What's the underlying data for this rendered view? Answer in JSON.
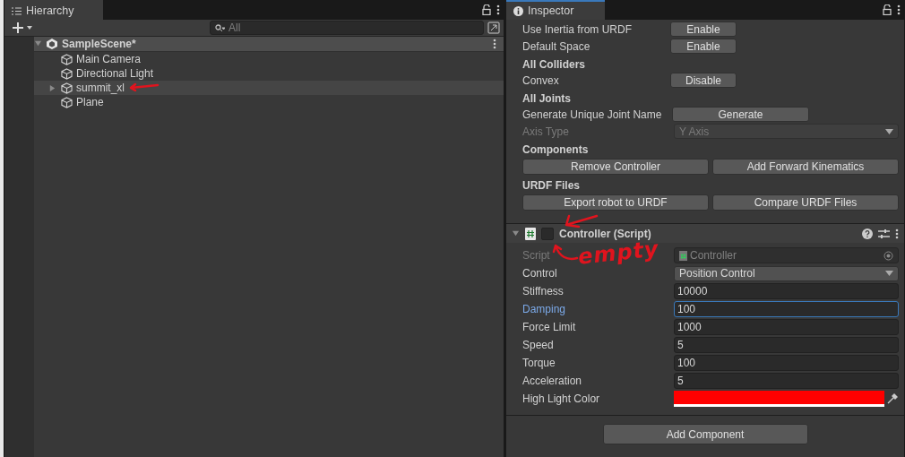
{
  "hierarchy": {
    "tab": {
      "label": "Hierarchy",
      "selected": true
    },
    "search": {
      "placeholder": "All"
    },
    "scene": {
      "name": "SampleScene*",
      "expanded": true
    },
    "objects": [
      {
        "name": "Main Camera",
        "has_children": false,
        "highlighted": false
      },
      {
        "name": "Directional Light",
        "has_children": false,
        "highlighted": false
      },
      {
        "name": "summit_xl",
        "has_children": true,
        "highlighted": true
      },
      {
        "name": "Plane",
        "has_children": false,
        "highlighted": false
      }
    ]
  },
  "inspector": {
    "tab": {
      "label": "Inspector",
      "selected": true
    },
    "items": [
      {
        "kind": "button_row",
        "label": "Use Inertia from URDF",
        "button": "Enable"
      },
      {
        "kind": "button_row",
        "label": "Default Space",
        "button": "Enable"
      },
      {
        "kind": "heading",
        "label": "All Colliders"
      },
      {
        "kind": "button_row",
        "label": "Convex",
        "button": "Disable"
      },
      {
        "kind": "heading",
        "label": "All Joints"
      },
      {
        "kind": "wide_button_row",
        "label": "Generate Unique Joint Name",
        "button": "Generate"
      },
      {
        "kind": "dropdown_row",
        "label": "Axis Type",
        "value": "Y Axis",
        "disabled": true
      },
      {
        "kind": "heading",
        "label": "Components"
      },
      {
        "kind": "button_pair",
        "buttons": [
          "Remove Controller",
          "Add Forward Kinematics"
        ]
      },
      {
        "kind": "heading",
        "label": "URDF Files"
      },
      {
        "kind": "button_pair",
        "buttons": [
          "Export robot to URDF",
          "Compare URDF Files"
        ]
      }
    ],
    "component": {
      "title": "Controller (Script)",
      "expanded": true,
      "enabled": false,
      "fields": [
        {
          "kind": "object",
          "label": "Script",
          "value": "Controller",
          "disabled": true,
          "focused": false
        },
        {
          "kind": "dropdown",
          "label": "Control",
          "value": "Position Control",
          "disabled": false,
          "focused": false
        },
        {
          "kind": "number",
          "label": "Stiffness",
          "value": "10000",
          "disabled": false,
          "focused": false
        },
        {
          "kind": "number",
          "label": "Damping",
          "value": "100",
          "disabled": false,
          "focused": true
        },
        {
          "kind": "number",
          "label": "Force Limit",
          "value": "1000",
          "disabled": false,
          "focused": false
        },
        {
          "kind": "number",
          "label": "Speed",
          "value": "5",
          "disabled": false,
          "focused": false
        },
        {
          "kind": "number",
          "label": "Torque",
          "value": "100",
          "disabled": false,
          "focused": false
        },
        {
          "kind": "number",
          "label": "Acceleration",
          "value": "5",
          "disabled": false,
          "focused": false
        },
        {
          "kind": "color",
          "label": "High Light Color",
          "color": "#ff0000",
          "disabled": false,
          "focused": false
        }
      ]
    },
    "add_button": "Add Component"
  },
  "annotation": {
    "text": "empty",
    "color": "#e0141e"
  }
}
